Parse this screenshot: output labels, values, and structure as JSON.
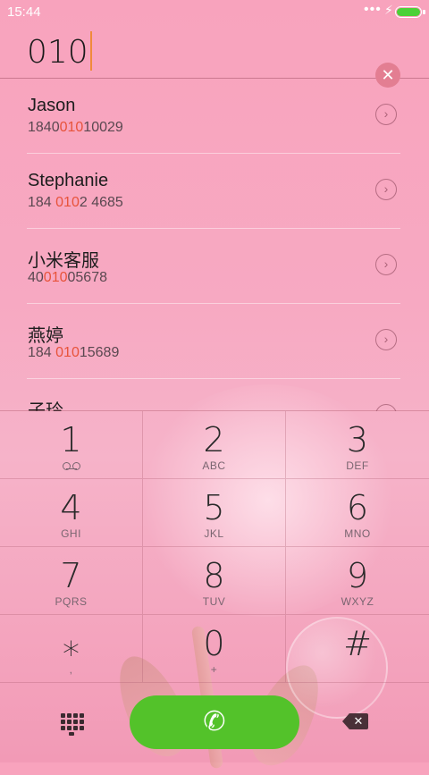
{
  "status_bar": {
    "time": "15:44",
    "dots": "•••",
    "bolt": "⚡"
  },
  "dialer": {
    "number": "010"
  },
  "icons": {
    "clear": "close-circle-icon",
    "detail": "chevron-right-circle-icon",
    "voicemail": "voicemail-icon",
    "dialpad": "dialpad-icon",
    "call": "phone-icon",
    "backspace": "backspace-icon"
  },
  "colors": {
    "highlight": "#e8533a",
    "call_green": "#53c22a",
    "battery": "#4cd137"
  },
  "contacts": [
    {
      "name": "Jason",
      "num_pre": "1840",
      "num_match": "010",
      "num_post": "10029"
    },
    {
      "name": "Stephanie",
      "num_pre": "184 ",
      "num_match": "010",
      "num_post": "2 4685"
    },
    {
      "name": "小米客服",
      "num_pre": "40",
      "num_match": "010",
      "num_post": "05678"
    },
    {
      "name": "燕婷",
      "num_pre": "184 ",
      "num_match": "010",
      "num_post": "15689"
    },
    {
      "name": "子玲",
      "num_pre": "",
      "num_match": "",
      "num_post": ""
    }
  ],
  "keypad": [
    {
      "digit": "1",
      "letters": ""
    },
    {
      "digit": "2",
      "letters": "ABC"
    },
    {
      "digit": "3",
      "letters": "DEF"
    },
    {
      "digit": "4",
      "letters": "GHI"
    },
    {
      "digit": "5",
      "letters": "JKL"
    },
    {
      "digit": "6",
      "letters": "MNO"
    },
    {
      "digit": "7",
      "letters": "PQRS"
    },
    {
      "digit": "8",
      "letters": "TUV"
    },
    {
      "digit": "9",
      "letters": "WXYZ"
    },
    {
      "digit": "⁎",
      "letters": ","
    },
    {
      "digit": "0",
      "letters": "+"
    },
    {
      "digit": "#",
      "letters": ""
    }
  ],
  "bottom_bar": {
    "call_glyph": "✆",
    "backspace_glyph": "✕"
  }
}
